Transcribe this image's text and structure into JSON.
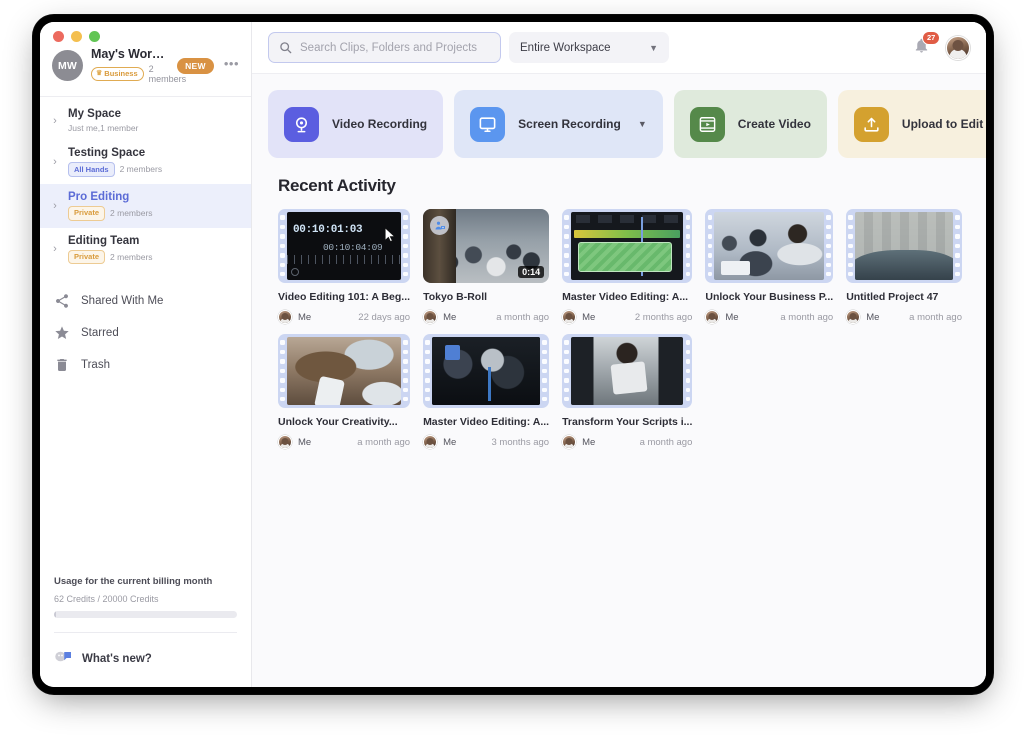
{
  "workspace": {
    "avatar_initials": "MW",
    "name": "May's Workspace",
    "plan_badge": "Business",
    "members": "2 members",
    "new_pill": "NEW",
    "more_glyph": "•••"
  },
  "spaces": [
    {
      "name": "My Space",
      "sub": "Just me,1 member",
      "tag": null,
      "members": null,
      "active": false
    },
    {
      "name": "Testing Space",
      "sub": null,
      "tag": "All Hands",
      "tag_kind": "allhands",
      "members": "2 members",
      "active": false
    },
    {
      "name": "Pro Editing",
      "sub": null,
      "tag": "Private",
      "tag_kind": "private",
      "members": "2 members",
      "active": true
    },
    {
      "name": "Editing Team",
      "sub": null,
      "tag": "Private",
      "tag_kind": "private",
      "members": "2 members",
      "active": false
    }
  ],
  "nav": [
    {
      "label": "Shared With Me",
      "icon": "share-icon"
    },
    {
      "label": "Starred",
      "icon": "star-icon"
    },
    {
      "label": "Trash",
      "icon": "trash-icon"
    }
  ],
  "usage": {
    "title": "Usage for the current billing month",
    "counts": "62 Credits / 20000 Credits",
    "percent": 1
  },
  "whats_new": {
    "label": "What's new?"
  },
  "search": {
    "placeholder": "Search Clips, Folders and Projects",
    "value": "",
    "scope": "Entire Workspace"
  },
  "notifications": {
    "count": "27"
  },
  "actions": [
    {
      "label": "Video Recording",
      "color": "purple",
      "icon": "webcam-icon",
      "has_chevron": false
    },
    {
      "label": "Screen Recording",
      "color": "blue",
      "icon": "monitor-icon",
      "has_chevron": true
    },
    {
      "label": "Create Video",
      "color": "green",
      "icon": "film-play-icon",
      "has_chevron": false
    },
    {
      "label": "Upload to Edit",
      "color": "yellow",
      "icon": "upload-icon",
      "has_chevron": false
    }
  ],
  "recent": {
    "title": "Recent Activity",
    "items": [
      {
        "title": "Video Editing 101: A Beg...",
        "owner": "Me",
        "time": "22 days ago",
        "style": "film",
        "scene": "sc-timeline",
        "duration": null,
        "timecode_big": "00:10:01:03",
        "timecode_small": "00:10:04:09",
        "badge": null
      },
      {
        "title": "Tokyo B-Roll",
        "owner": "Me",
        "time": "a month ago",
        "style": "plain",
        "scene": "sc-street",
        "duration": "0:14",
        "badge": "camera-person-icon"
      },
      {
        "title": "Master Video Editing: A...",
        "owner": "Me",
        "time": "2 months ago",
        "style": "film",
        "scene": "sc-editor",
        "duration": null,
        "badge": null
      },
      {
        "title": "Unlock Your Business P...",
        "owner": "Me",
        "time": "a month ago",
        "style": "film",
        "scene": "sc-office",
        "duration": null,
        "badge": null
      },
      {
        "title": "Untitled Project 47",
        "owner": "Me",
        "time": "a month ago",
        "style": "film",
        "scene": "sc-car",
        "duration": null,
        "badge": null
      },
      {
        "title": "Unlock Your Creativity...",
        "owner": "Me",
        "time": "a month ago",
        "style": "film",
        "scene": "sc-portrait",
        "duration": null,
        "badge": null
      },
      {
        "title": "Master Video Editing: A...",
        "owner": "Me",
        "time": "3 months ago",
        "style": "film",
        "scene": "sc-studio",
        "duration": null,
        "badge": null
      },
      {
        "title": "Transform Your Scripts i...",
        "owner": "Me",
        "time": "a month ago",
        "style": "film",
        "scene": "sc-present",
        "duration": null,
        "badge": null
      }
    ]
  },
  "colors": {
    "accent": "#5b6bd6",
    "purple": "#5b5ee0",
    "blue": "#5b96ef",
    "green": "#55894a",
    "yellow": "#d4a12f",
    "badge_red": "#e05c45",
    "orange_pill": "#d99243"
  }
}
